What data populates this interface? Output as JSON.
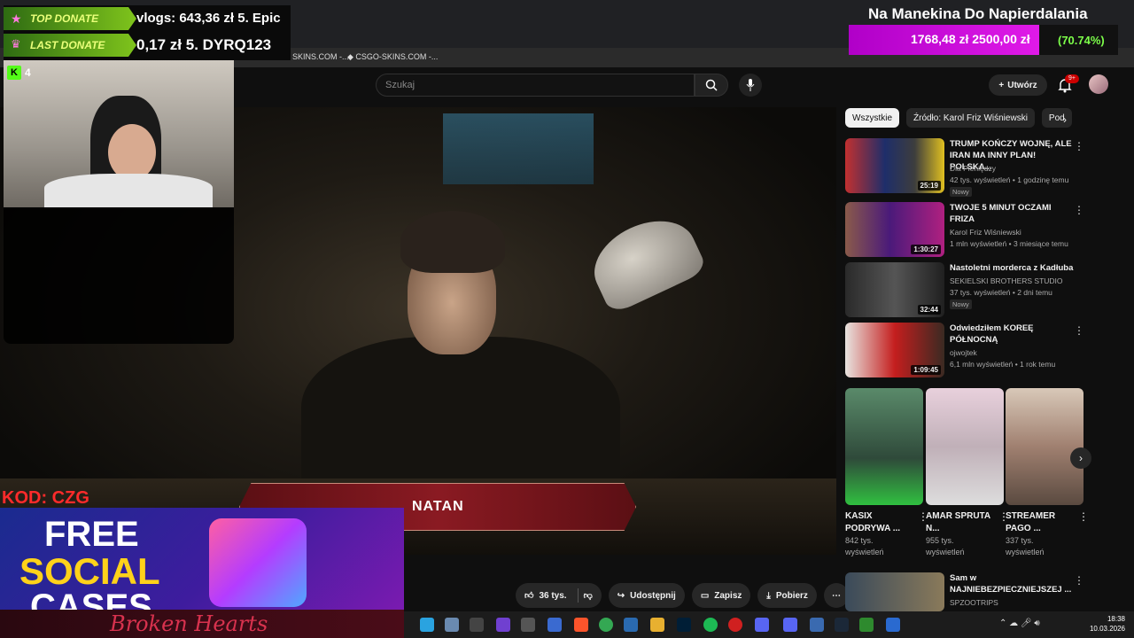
{
  "browser": {
    "bookmarks": [
      "SKINS.COM -...",
      "CSGO-SKINS.COM -..."
    ]
  },
  "youtube": {
    "search_placeholder": "Szukaj",
    "create_label": "Utwórz",
    "notifications_badge": "9+"
  },
  "video": {
    "nameplate": "NATAN"
  },
  "actions": {
    "likes": "36 tys.",
    "share": "Udostępnij",
    "save": "Zapisz",
    "download": "Pobierz"
  },
  "sidebar": {
    "chips": [
      "Wszystkie",
      "Źródło: Karol Friz Wiśniewski",
      "Pod"
    ],
    "recommendations": [
      {
        "title": "TRUMP KOŃCZY WOJNĘ, ALE IRAN MA INNY PLAN! POLSKA...",
        "channel": "Dla Pieniędzy",
        "meta": "42 tys. wyświetleń • 1 godzinę temu",
        "badge": "Nowy",
        "duration": "25:19"
      },
      {
        "title": "TWOJE 5 MINUT OCZAMI FRIZA",
        "channel": "Karol Friz Wiśniewski",
        "meta": "1 mln wyświetleń • 3 miesiące temu",
        "badge": "",
        "duration": "1:30:27"
      },
      {
        "title": "Nastoletni morderca z Kadłuba",
        "channel": "SEKIELSKI BROTHERS STUDIO",
        "meta": "37 tys. wyświetleń • 2 dni temu",
        "badge": "Nowy",
        "duration": "32:44"
      },
      {
        "title": "Odwiedziłem KOREĘ PÓŁNOCNĄ",
        "channel": "ojwojtek",
        "meta": "6,1 mln wyświetleń • 1 rok temu",
        "badge": "",
        "duration": "1:09:45"
      }
    ],
    "shorts": [
      {
        "title": "KASIX PODRYWA ...",
        "views": "842 tys. wyświetleń"
      },
      {
        "title": "AMAR SPRUTA N...",
        "views": "955 tys. wyświetleń"
      },
      {
        "title": "STREAMER PAGO ...",
        "views": "337 tys. wyświetleń"
      }
    ],
    "last": {
      "title": "Sam w NAJNIEBEZPIECZNIEJSZEJ ...",
      "channel": "SPZOOTRIPS"
    }
  },
  "overlay": {
    "top_donate_label": "TOP DONATE",
    "top_donate_value": "vlogs: 643,36 zł  5. Epic",
    "last_donate_label": "LAST DONATE",
    "last_donate_value": "0,17 zł 5. DYRQ123",
    "goal_title": "Na Manekina Do Napierdalania",
    "goal_text": "1768,48 zł  2500,00 zł",
    "goal_pct": "(70.74%)",
    "goal_fraction": 0.7074,
    "kick_count": "4",
    "kod": "KOD: CZG",
    "promo_lines": [
      "FREE",
      "SOCIAL",
      "CASES"
    ],
    "broken": "Broken Hearts"
  },
  "taskbar": {
    "time": "18:38",
    "date": "10.03.2026"
  }
}
